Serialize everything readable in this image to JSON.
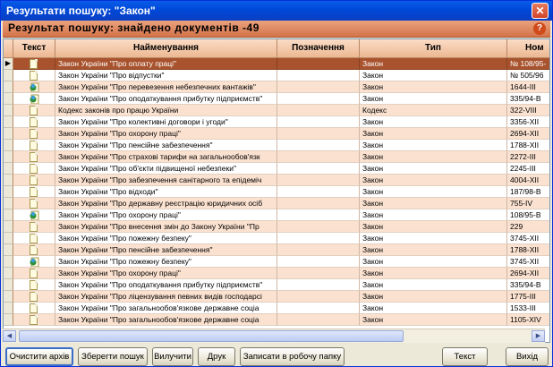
{
  "window": {
    "title": "Результати пошуку: \"Закон\"",
    "close_glyph": "✕"
  },
  "header": {
    "text": "Результат пошуку: знайдено документів -49",
    "help_glyph": "?"
  },
  "columns": [
    "Текст",
    "Найменування",
    "Позначення",
    "Тип",
    "Ном"
  ],
  "rows": [
    {
      "icon": "doc",
      "name": "Закон України \"Про оплату праці\"",
      "code": "",
      "type": "Закон",
      "num": "№ 108/95-",
      "selected": true
    },
    {
      "icon": "doc",
      "name": "Закон України \"Про відпустки\"",
      "code": "",
      "type": "Закон",
      "num": "№ 505/96"
    },
    {
      "icon": "update",
      "name": "Закон України \"Про перевезення небезпечних вантажів\"",
      "code": "",
      "type": "Закон",
      "num": "1644-III"
    },
    {
      "icon": "update",
      "name": "Закон України \"Про оподаткування прибутку підприємств\"",
      "code": "",
      "type": "Закон",
      "num": "335/94-В"
    },
    {
      "icon": "doc",
      "name": "Кодекс законів про працю України",
      "code": "",
      "type": "Кодекс",
      "num": "322-VIII"
    },
    {
      "icon": "doc",
      "name": "Закон України \"Про колективні договори і угоди\"",
      "code": "",
      "type": "Закон",
      "num": "3356-XII"
    },
    {
      "icon": "doc",
      "name": "Закон України \"Про охорону праці\"",
      "code": "",
      "type": "Закон",
      "num": "2694-XII"
    },
    {
      "icon": "doc",
      "name": "Закон України \"Про пенсійне забезпечення\"",
      "code": "",
      "type": "Закон",
      "num": "1788-XII"
    },
    {
      "icon": "doc",
      "name": "Закон України \"Про страхові тарифи на загальнообов'язк",
      "code": "",
      "type": "Закон",
      "num": "2272-III"
    },
    {
      "icon": "doc",
      "name": "Закон України \"Про об'єкти підвищеної небезпеки\"",
      "code": "",
      "type": "Закон",
      "num": "2245-III"
    },
    {
      "icon": "doc",
      "name": "Закон України \"Про забезпечення санітарного та епідеміч",
      "code": "",
      "type": "Закон",
      "num": "4004-XII"
    },
    {
      "icon": "doc",
      "name": "Закон України \"Про відходи\"",
      "code": "",
      "type": "Закон",
      "num": "187/98-В"
    },
    {
      "icon": "doc",
      "name": "Закон України \"Про державну реєстрацію юридичних осіб",
      "code": "",
      "type": "Закон",
      "num": "755-IV"
    },
    {
      "icon": "update",
      "name": "Закон України \"Про охорону праці\"",
      "code": "",
      "type": "Закон",
      "num": "108/95-В"
    },
    {
      "icon": "doc",
      "name": "Закон України \"Про внесення змін до Закону України \"Пр",
      "code": "",
      "type": "Закон",
      "num": "229"
    },
    {
      "icon": "doc",
      "name": "Закон України \"Про пожежну безпеку\"",
      "code": "",
      "type": "Закон",
      "num": "3745-XII"
    },
    {
      "icon": "doc",
      "name": "Закон України \"Про пенсійне забезпечення\"",
      "code": "",
      "type": "Закон",
      "num": "1788-XII"
    },
    {
      "icon": "update",
      "name": "Закон України \"Про пожежну безпеку\"",
      "code": "",
      "type": "Закон",
      "num": "3745-XII"
    },
    {
      "icon": "doc",
      "name": "Закон України \"Про охорону праці\"",
      "code": "",
      "type": "Закон",
      "num": "2694-XII"
    },
    {
      "icon": "doc",
      "name": "Закон України \"Про оподаткування прибутку підприємств\"",
      "code": "",
      "type": "Закон",
      "num": "335/94-В"
    },
    {
      "icon": "doc",
      "name": "Закон України \"Про ліцензування певних видів господарсі",
      "code": "",
      "type": "Закон",
      "num": "1775-III"
    },
    {
      "icon": "doc",
      "name": "Закон України \"Про загальнообов'язкове державне соціа",
      "code": "",
      "type": "Закон",
      "num": "1533-III"
    },
    {
      "icon": "doc",
      "name": "Закон України \"Про загальнообов'язкове державне соціа",
      "code": "",
      "type": "Закон",
      "num": "1105-XIV"
    }
  ],
  "buttons": {
    "clear_archive": "Очистити архів",
    "save_search": "Зберегти пошук",
    "delete": "Вилучити",
    "print": "Друк",
    "write_workfolder": "Записати в робочу папку",
    "text": "Текст",
    "exit": "Вихід"
  },
  "colors": {
    "selected_row": "#a8532e",
    "odd_row": "#fbe2d0",
    "header": "#d4734a"
  }
}
